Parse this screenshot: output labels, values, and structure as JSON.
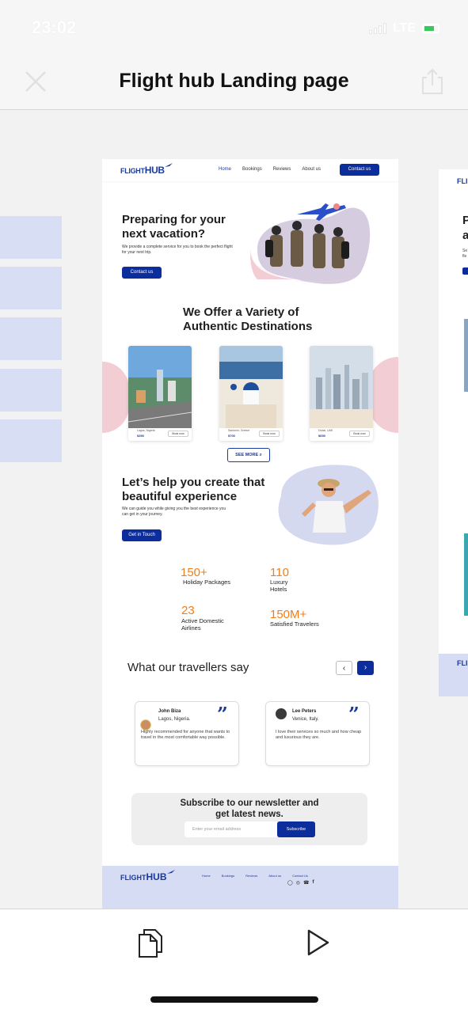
{
  "status": {
    "time": "23:02",
    "network": "LTE"
  },
  "appbar": {
    "title": "Flight hub Landing page"
  },
  "design": {
    "nav": {
      "logo_flight": "FLIGHT",
      "logo_hub": "HUB",
      "links": [
        "Home",
        "Bookings",
        "Reviews",
        "About us"
      ],
      "cta": "Contact us"
    },
    "hero": {
      "title": "Preparing for your next vacation?",
      "subtitle": "We provide a complete service for you to book the perfect flight for your next trip.",
      "cta": "Contact us"
    },
    "destinations": {
      "title": "We Offer a Variety of Authentic Destinations",
      "cards": [
        {
          "name": "Lagos, Nigeria",
          "price": "$350",
          "book": "Book now"
        },
        {
          "name": "Santorini, Greece",
          "price": "$700",
          "book": "Book now"
        },
        {
          "name": "Dubai, UAE",
          "price": "$650",
          "book": "Book now"
        }
      ],
      "see_more": "SEE MORE"
    },
    "help": {
      "title": "Let’s help you create that beautiful experience",
      "subtitle": "We can guide you while giving you the best experience you can get in your journey.",
      "cta": "Get in Touch"
    },
    "stats": [
      {
        "value": "150+",
        "label": "Holiday Packages"
      },
      {
        "value": "110",
        "label": "Luxury Hotels"
      },
      {
        "value": "23",
        "label": "Active Domestic Airlines"
      },
      {
        "value": "150M+",
        "label": "Satisfied Travelers"
      }
    ],
    "testimonials": {
      "title": "What our travellers say",
      "prev": "‹",
      "next": "›",
      "items": [
        {
          "name": "John Biza",
          "location": "Lagos, Nigeria.",
          "text": "Highly recommended for anyone that wants to travel in the most comfortable way possible."
        },
        {
          "name": "Lee Peters",
          "location": "Venice, Italy.",
          "text": "I love their services so much and how cheap and luxurious they are."
        }
      ]
    },
    "newsletter": {
      "title": "Subscribe to our newsletter and get latest news.",
      "placeholder": "Enter your email address",
      "button": "Subscribe"
    },
    "footer": {
      "links": [
        "Home",
        "Bookings",
        "Reviews",
        "About us",
        "Contact Us"
      ],
      "social": [
        "instagram-icon",
        "twitter-icon",
        "whatsapp-icon",
        "facebook-icon"
      ]
    }
  },
  "colors": {
    "brand_blue": "#0c2d9c",
    "accent_orange": "#f07e1b",
    "pink": "#f3cdd4",
    "footer_bg": "#d6dcf4"
  }
}
